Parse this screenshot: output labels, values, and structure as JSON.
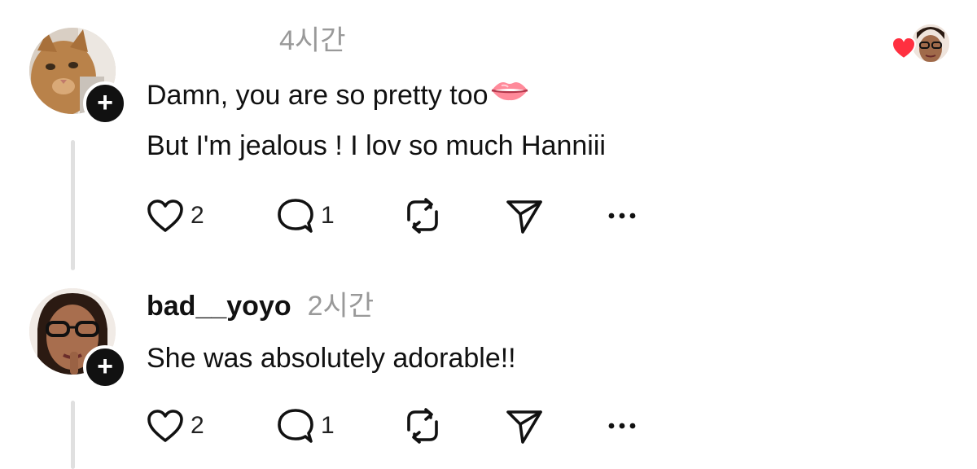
{
  "comments": [
    {
      "username": "",
      "timestamp": "4시간",
      "lines": [
        "Damn, you are so pretty too",
        "But I'm jealous ! I lov so much Hanniii"
      ],
      "likes": "2",
      "replies": "1",
      "liked_by_author": true
    },
    {
      "username": "bad__yoyo",
      "timestamp": "2시간",
      "lines": [
        "She was absolutely adorable!!"
      ],
      "likes": "2",
      "replies": "1"
    }
  ],
  "icons": {
    "like": "heart-outline-icon",
    "reply": "speech-bubble-icon",
    "repost": "repost-arrows-icon",
    "share": "paper-plane-icon",
    "more": "more-dots-icon",
    "emoji": "lips-emoji",
    "author_like": "red-heart-icon"
  },
  "colors": {
    "text": "#111111",
    "muted": "#999999",
    "thread_line": "#e0e0e0",
    "heart": "#ff3040",
    "follow_button": "#111111"
  }
}
